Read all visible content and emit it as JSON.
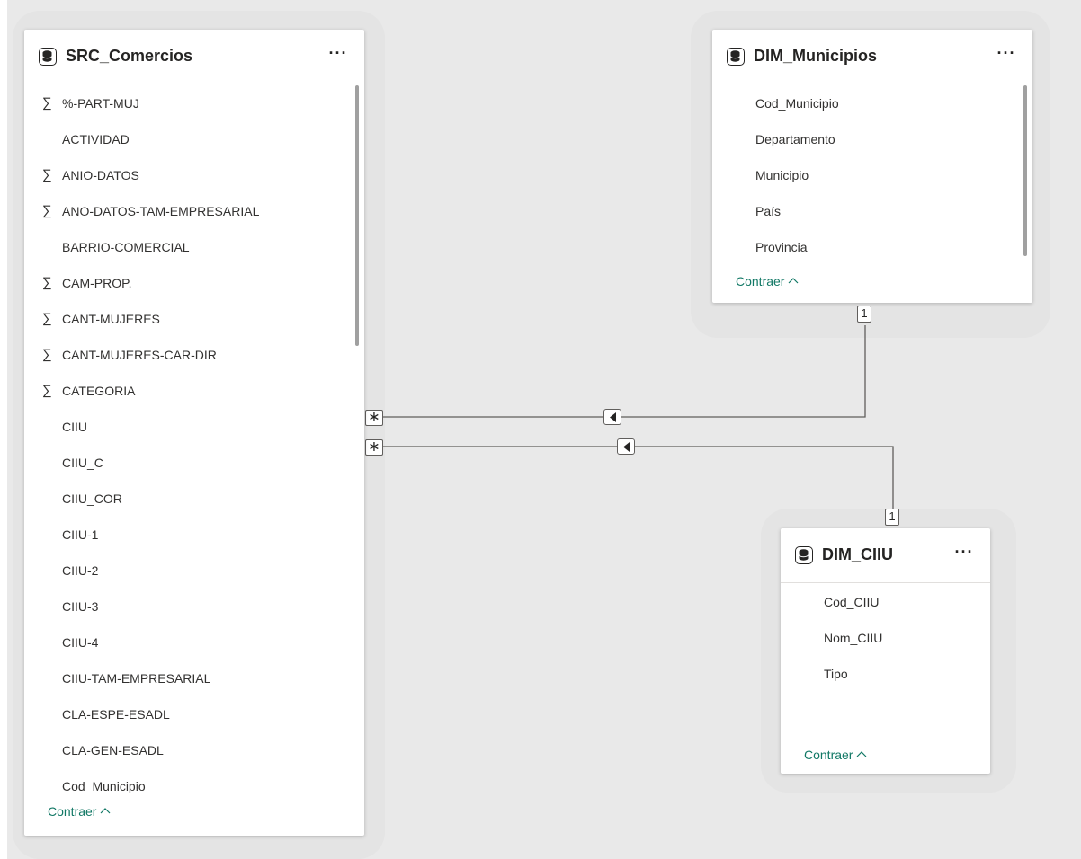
{
  "tables": {
    "src_comercios": {
      "title": "SRC_Comercios",
      "menu": "···",
      "fields": [
        {
          "label": "%-PART-MUJ",
          "aggregate": true
        },
        {
          "label": "ACTIVIDAD",
          "aggregate": false
        },
        {
          "label": "ANIO-DATOS",
          "aggregate": true
        },
        {
          "label": "ANO-DATOS-TAM-EMPRESARIAL",
          "aggregate": true
        },
        {
          "label": "BARRIO-COMERCIAL",
          "aggregate": false
        },
        {
          "label": "CAM-PROP.",
          "aggregate": true
        },
        {
          "label": "CANT-MUJERES",
          "aggregate": true
        },
        {
          "label": "CANT-MUJERES-CAR-DIR",
          "aggregate": true
        },
        {
          "label": "CATEGORIA",
          "aggregate": true
        },
        {
          "label": "CIIU",
          "aggregate": false
        },
        {
          "label": "CIIU_C",
          "aggregate": false
        },
        {
          "label": "CIIU_COR",
          "aggregate": false
        },
        {
          "label": "CIIU-1",
          "aggregate": false
        },
        {
          "label": "CIIU-2",
          "aggregate": false
        },
        {
          "label": "CIIU-3",
          "aggregate": false
        },
        {
          "label": "CIIU-4",
          "aggregate": false
        },
        {
          "label": "CIIU-TAM-EMPRESARIAL",
          "aggregate": false
        },
        {
          "label": "CLA-ESPE-ESADL",
          "aggregate": false
        },
        {
          "label": "CLA-GEN-ESADL",
          "aggregate": false
        },
        {
          "label": "Cod_Municipio",
          "aggregate": false
        }
      ],
      "collapse_label": "Contraer"
    },
    "dim_municipios": {
      "title": "DIM_Municipios",
      "menu": "···",
      "fields": [
        {
          "label": "Cod_Municipio",
          "aggregate": false
        },
        {
          "label": "Departamento",
          "aggregate": false
        },
        {
          "label": "Municipio",
          "aggregate": false
        },
        {
          "label": "País",
          "aggregate": false
        },
        {
          "label": "Provincia",
          "aggregate": false
        }
      ],
      "collapse_label": "Contraer"
    },
    "dim_ciiu": {
      "title": "DIM_CIIU",
      "menu": "···",
      "fields": [
        {
          "label": "Cod_CIIU",
          "aggregate": false
        },
        {
          "label": "Nom_CIIU",
          "aggregate": false
        },
        {
          "label": "Tipo",
          "aggregate": false
        }
      ],
      "collapse_label": "Contraer"
    }
  },
  "symbols": {
    "sigma": "∑",
    "many": "∗",
    "one": "1"
  },
  "relationships": [
    {
      "from": "SRC_Comercios",
      "to": "DIM_Municipios",
      "from_cardinality": "∗",
      "to_cardinality": "1",
      "direction": "single"
    },
    {
      "from": "SRC_Comercios",
      "to": "DIM_CIIU",
      "from_cardinality": "∗",
      "to_cardinality": "1",
      "direction": "single"
    }
  ],
  "colors": {
    "canvas": "#e9e9e9",
    "card": "#ffffff",
    "link": "#117865",
    "line": "#605e5c"
  }
}
